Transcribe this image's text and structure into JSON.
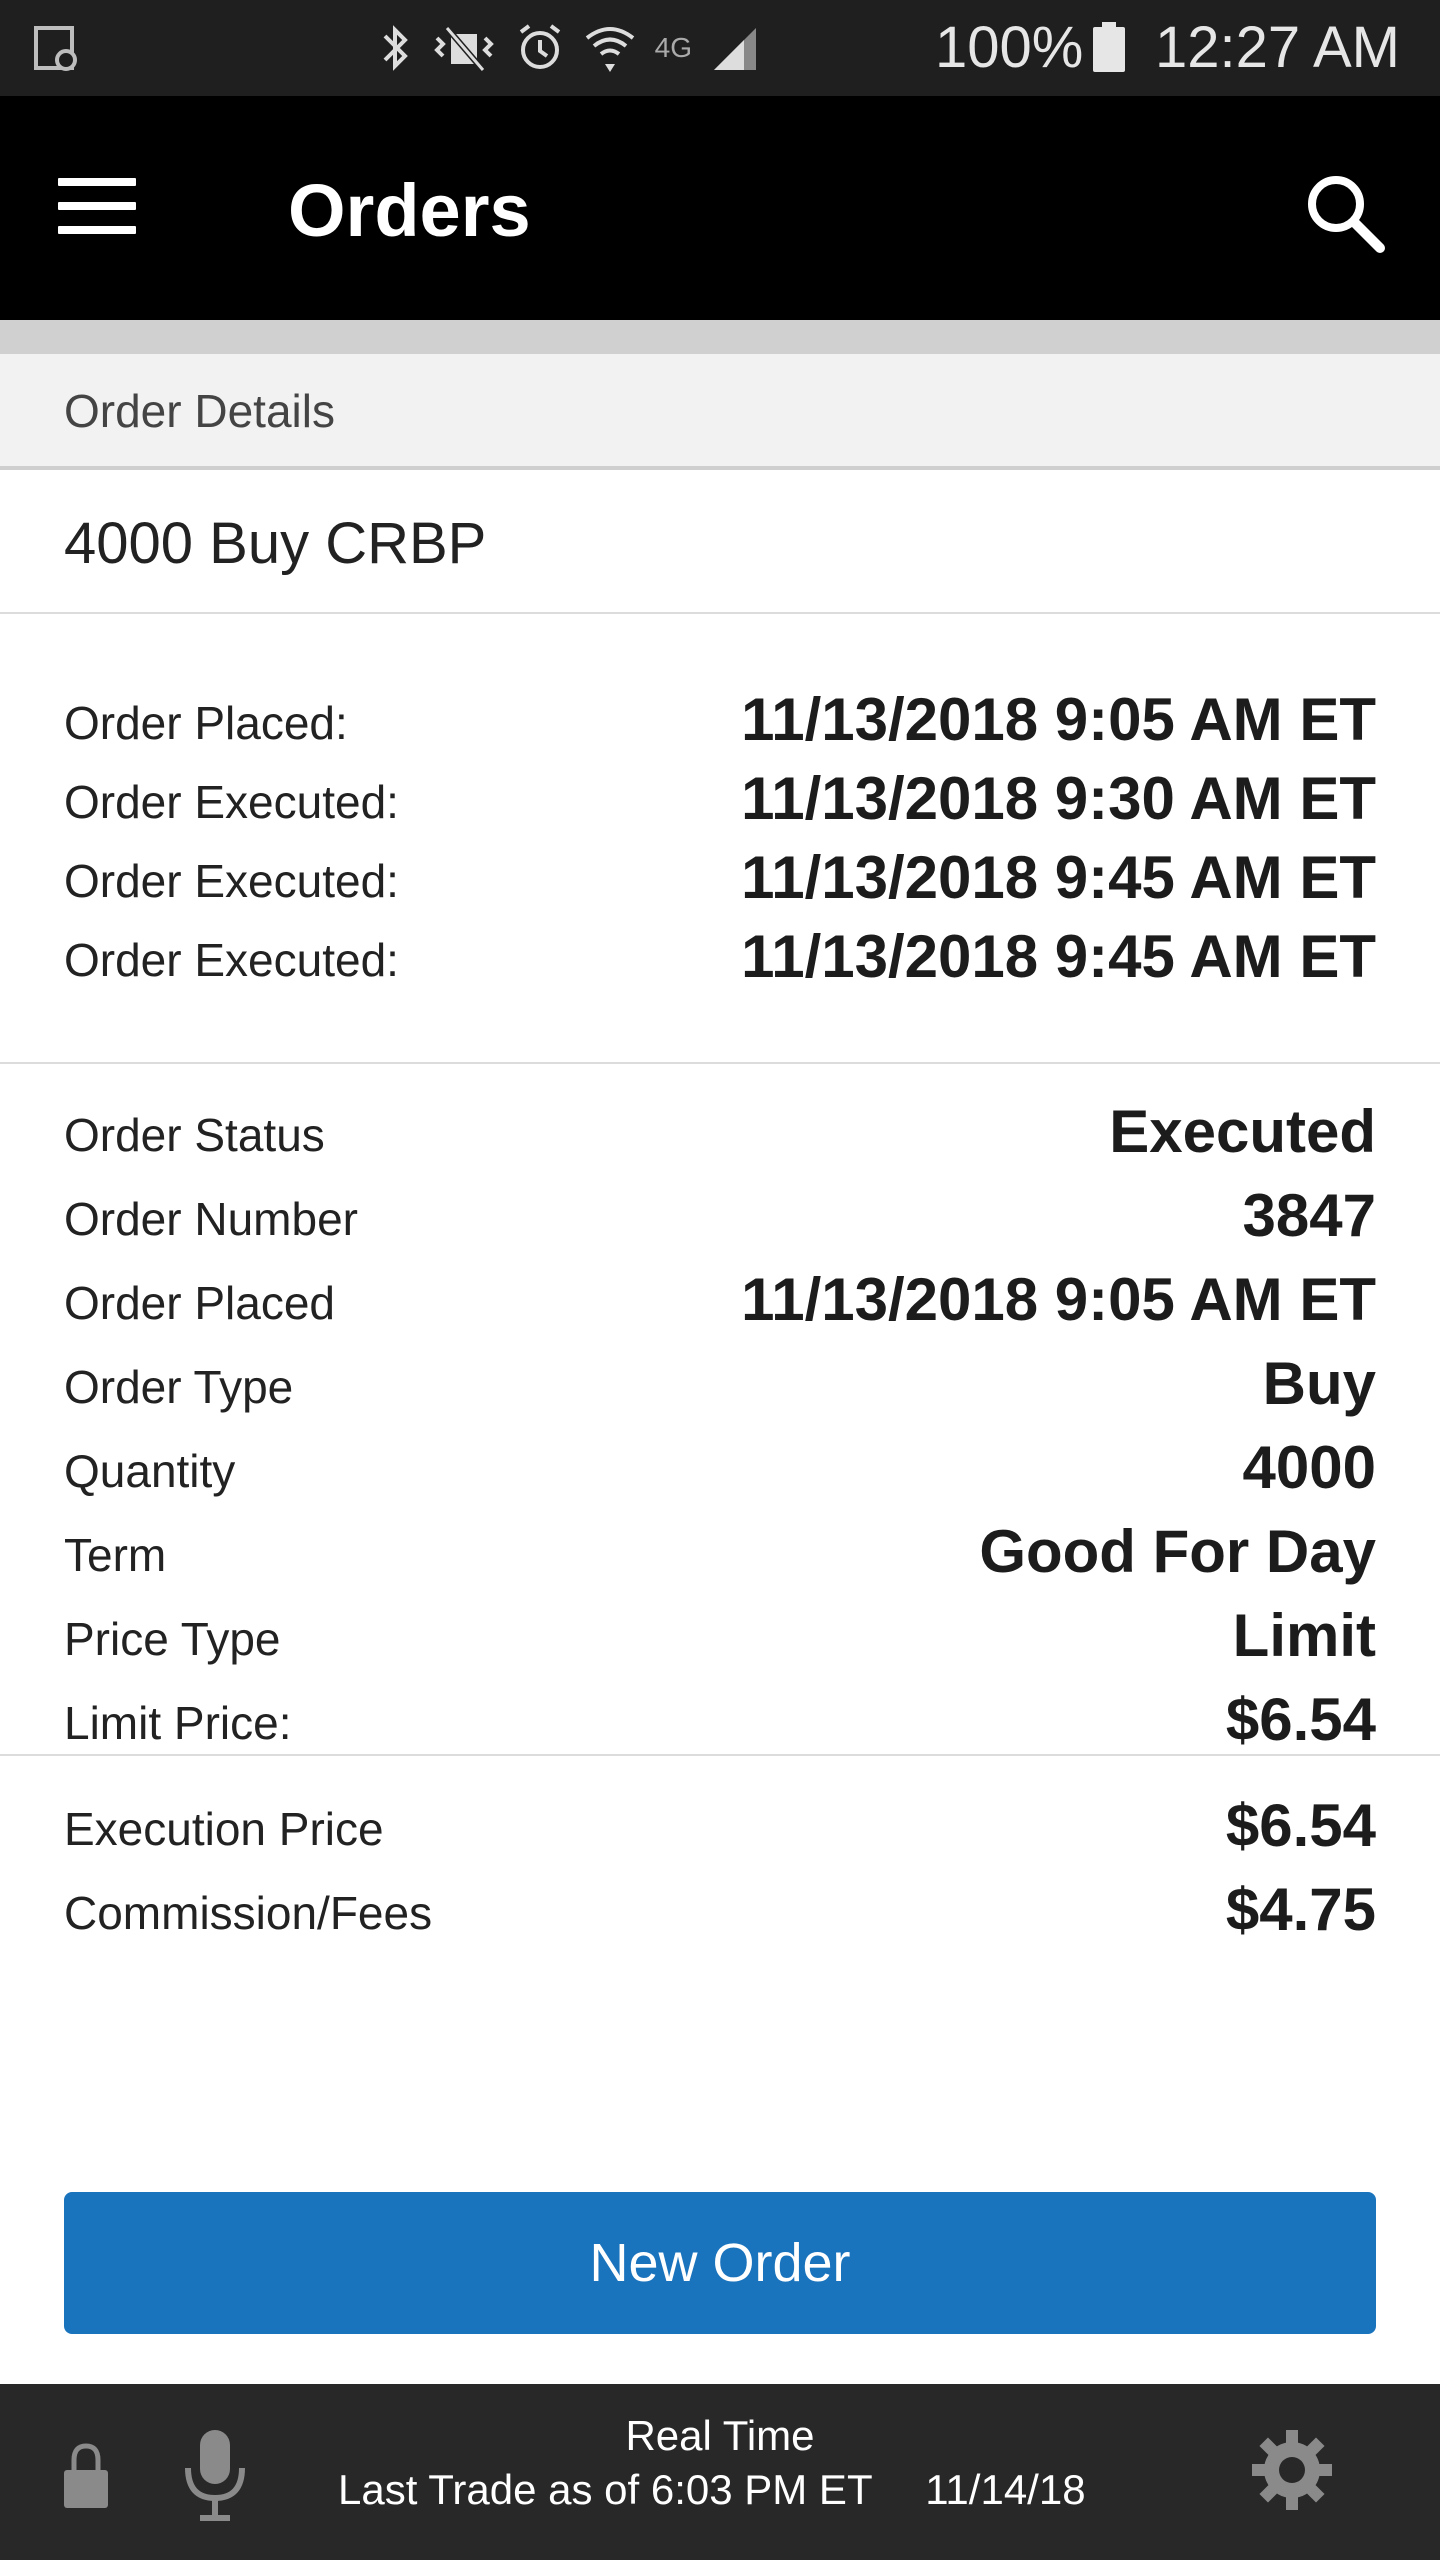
{
  "status_bar": {
    "battery_percent": "100%",
    "time": "12:27 AM",
    "network_label": "4G",
    "icons": [
      "screen-record-icon",
      "bluetooth-icon",
      "vibrate-icon",
      "alarm-icon",
      "wifi-icon",
      "lte-icon",
      "signal-icon",
      "battery-icon"
    ]
  },
  "appbar": {
    "title": "Orders",
    "menu_icon": "hamburger-menu-icon",
    "search_icon": "search-icon"
  },
  "section": {
    "header": "Order Details"
  },
  "order_summary": "4000 Buy CRBP",
  "events": [
    {
      "label": "Order Placed:",
      "value": "11/13/2018 9:05 AM ET"
    },
    {
      "label": "Order Executed:",
      "value": "11/13/2018 9:30 AM ET"
    },
    {
      "label": "Order Executed:",
      "value": "11/13/2018 9:45 AM ET"
    },
    {
      "label": "Order Executed:",
      "value": "11/13/2018 9:45 AM ET"
    }
  ],
  "details": [
    {
      "label": "Order Status",
      "value": "Executed"
    },
    {
      "label": "Order Number",
      "value": "3847"
    },
    {
      "label": "Order Placed",
      "value": "11/13/2018 9:05 AM ET"
    },
    {
      "label": "Order Type",
      "value": "Buy"
    },
    {
      "label": "Quantity",
      "value": "4000"
    },
    {
      "label": "Term",
      "value": "Good For Day"
    },
    {
      "label": "Price Type",
      "value": "Limit"
    },
    {
      "label": "Limit Price:",
      "value": "$6.54"
    }
  ],
  "execution": [
    {
      "label": "Execution Price",
      "value": "$6.54"
    },
    {
      "label": "Commission/Fees",
      "value": "$4.75"
    }
  ],
  "button": {
    "new_order": "New Order"
  },
  "footer": {
    "real_time": "Real Time",
    "last_trade": "Last Trade as of 6:03 PM ET",
    "date": "11/14/18",
    "icons": [
      "lock-icon",
      "microphone-icon",
      "settings-gear-icon"
    ]
  },
  "colors": {
    "button_blue": "#1a73bd",
    "appbar_black": "#000000",
    "footer_gray": "#282828"
  }
}
